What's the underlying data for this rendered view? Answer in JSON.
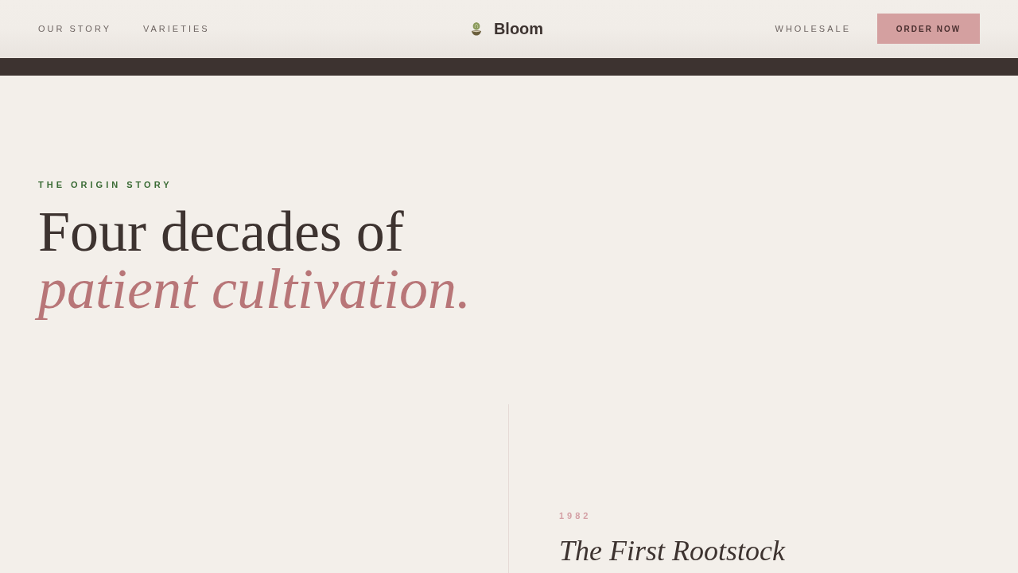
{
  "nav": {
    "links_left": [
      {
        "label": "OUR STORY"
      },
      {
        "label": "VARIETIES"
      }
    ],
    "logo": {
      "name": "Bloom"
    },
    "links_right": [
      {
        "label": "WHOLESALE"
      }
    ],
    "cta": {
      "label": "ORDER NOW"
    }
  },
  "hero": {
    "eyebrow": "THE ORIGIN STORY",
    "title_line_1": "Four decades of",
    "title_line_2": "patient cultivation."
  },
  "timeline": [
    {
      "year": "1982",
      "title": "The First Rootstock"
    }
  ]
}
